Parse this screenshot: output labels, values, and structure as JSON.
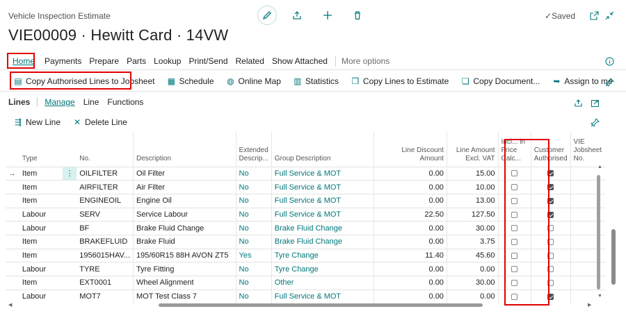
{
  "header": {
    "caption": "Vehicle Inspection Estimate",
    "title": "VIE00009 · Hewitt Card · 14VW",
    "saved_label": "Saved"
  },
  "menu": {
    "items": [
      "Home",
      "Payments",
      "Prepare",
      "Parts",
      "Lookup",
      "Print/Send",
      "Related",
      "Show Attached"
    ],
    "more": "More options"
  },
  "actions": [
    {
      "label": "Copy Authorised Lines to Jobsheet",
      "icon": "document-copy-icon"
    },
    {
      "label": "Schedule",
      "icon": "calendar-icon"
    },
    {
      "label": "Online Map",
      "icon": "globe-icon"
    },
    {
      "label": "Statistics",
      "icon": "chart-icon"
    },
    {
      "label": "Copy Lines to Estimate",
      "icon": "copy-lines-icon"
    },
    {
      "label": "Copy Document...",
      "icon": "copy-document-icon"
    },
    {
      "label": "Assign to me",
      "icon": "assign-arrow-icon"
    }
  ],
  "lines": {
    "title": "Lines",
    "tabs": [
      "Manage",
      "Line",
      "Functions"
    ],
    "new_line": "New Line",
    "delete_line": "Delete Line",
    "columns": [
      "Type",
      "No.",
      "Description",
      "Extended Descrip...",
      "Group Description",
      "Line Discount Amount",
      "Line Amount Excl. VAT",
      "Incl... in Price Calc...",
      "Customer Authorised",
      "VIE Jobsheet No."
    ],
    "rows": [
      {
        "type": "Item",
        "no": "OILFILTER",
        "desc": "Oil Filter",
        "ext": "No",
        "group": "Full Service & MOT",
        "disc": "0.00",
        "amt": "15.00",
        "incl": false,
        "auth": true
      },
      {
        "type": "Item",
        "no": "AIRFILTER",
        "desc": "Air Filter",
        "ext": "No",
        "group": "Full Service & MOT",
        "disc": "0.00",
        "amt": "10.00",
        "incl": false,
        "auth": true
      },
      {
        "type": "Item",
        "no": "ENGINEOIL",
        "desc": "Engine Oil",
        "ext": "No",
        "group": "Full Service & MOT",
        "disc": "0.00",
        "amt": "13.00",
        "incl": false,
        "auth": true
      },
      {
        "type": "Labour",
        "no": "SERV",
        "desc": "Service Labour",
        "ext": "No",
        "group": "Full Service & MOT",
        "disc": "22.50",
        "amt": "127.50",
        "incl": false,
        "auth": true
      },
      {
        "type": "Labour",
        "no": "BF",
        "desc": "Brake Fluid Change",
        "ext": "No",
        "group": "Brake Fluid Change",
        "disc": "0.00",
        "amt": "30.00",
        "incl": false,
        "auth": false
      },
      {
        "type": "Item",
        "no": "BRAKEFLUID",
        "desc": "Brake Fluid",
        "ext": "No",
        "group": "Brake Fluid Change",
        "disc": "0.00",
        "amt": "3.75",
        "incl": false,
        "auth": false
      },
      {
        "type": "Item",
        "no": "1956015HAV...",
        "desc": "195/60R15 88H AVON ZT5",
        "ext": "Yes",
        "group": "Tyre Change",
        "disc": "11.40",
        "amt": "45.60",
        "incl": false,
        "auth": false
      },
      {
        "type": "Labour",
        "no": "TYRE",
        "desc": "Tyre Fitting",
        "ext": "No",
        "group": "Tyre Change",
        "disc": "0.00",
        "amt": "0.00",
        "incl": false,
        "auth": false
      },
      {
        "type": "Item",
        "no": "EXT0001",
        "desc": "Wheel Alignment",
        "ext": "No",
        "group": "Other",
        "disc": "0.00",
        "amt": "30.00",
        "incl": false,
        "auth": false
      },
      {
        "type": "Labour",
        "no": "MOT7",
        "desc": "MOT Test Class 7",
        "ext": "No",
        "group": "Full Service & MOT",
        "disc": "0.00",
        "amt": "0.00",
        "incl": false,
        "auth": true
      }
    ]
  },
  "colors": {
    "accent": "#00777a",
    "highlight": "#e00000"
  }
}
